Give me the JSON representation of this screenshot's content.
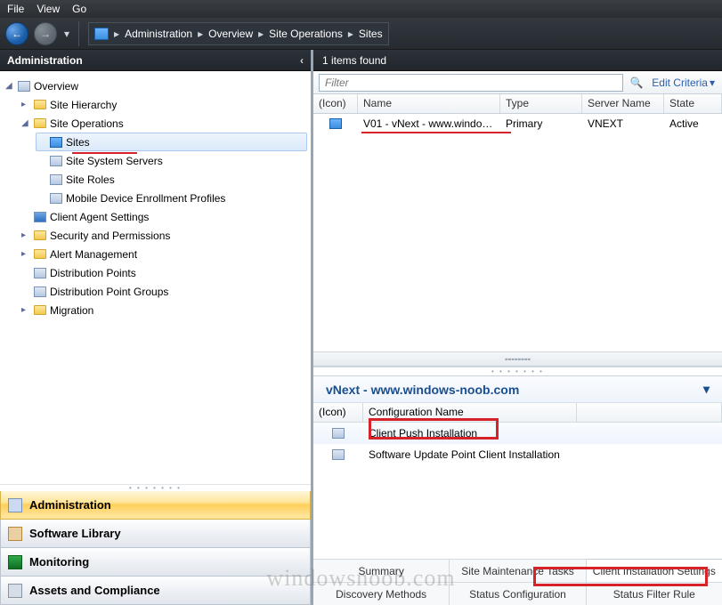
{
  "menu": {
    "file": "File",
    "view": "View",
    "go": "Go"
  },
  "breadcrumb": [
    "Administration",
    "Overview",
    "Site Operations",
    "Sites"
  ],
  "panelTitle": "Administration",
  "tree": {
    "overview": "Overview",
    "siteHierarchy": "Site Hierarchy",
    "siteOperations": "Site Operations",
    "sites": "Sites",
    "siteSystemServers": "Site System Servers",
    "siteRoles": "Site Roles",
    "mdep": "Mobile Device Enrollment Profiles",
    "clientAgent": "Client Agent Settings",
    "security": "Security and Permissions",
    "alertMgmt": "Alert Management",
    "distPoints": "Distribution Points",
    "distGroups": "Distribution Point Groups",
    "migration": "Migration"
  },
  "wunder": {
    "admin": "Administration",
    "lib": "Software Library",
    "mon": "Monitoring",
    "assets": "Assets and Compliance"
  },
  "list": {
    "countText": "1 items found",
    "filterPlaceholder": "Filter",
    "editCriteria": "Edit Criteria",
    "headers": {
      "icon": "(Icon)",
      "name": "Name",
      "type": "Type",
      "server": "Server Name",
      "state": "State"
    },
    "rows": [
      {
        "name": "V01 - vNext - www.windo…",
        "type": "Primary",
        "server": "VNEXT",
        "state": "Active"
      }
    ]
  },
  "detail": {
    "title": "vNext - www.windows-noob.com",
    "headers": {
      "icon": "(Icon)",
      "name": "Configuration Name"
    },
    "rows": [
      {
        "name": "Client Push Installation"
      },
      {
        "name": "Software Update Point Client Installation"
      }
    ],
    "tabsTop": [
      "Summary",
      "Site Maintenance Tasks",
      "Client Installation Settings"
    ],
    "tabsBottom": [
      "Discovery Methods",
      "Status Configuration",
      "Status Filter Rule"
    ]
  },
  "watermark": "windowsnoob.com"
}
